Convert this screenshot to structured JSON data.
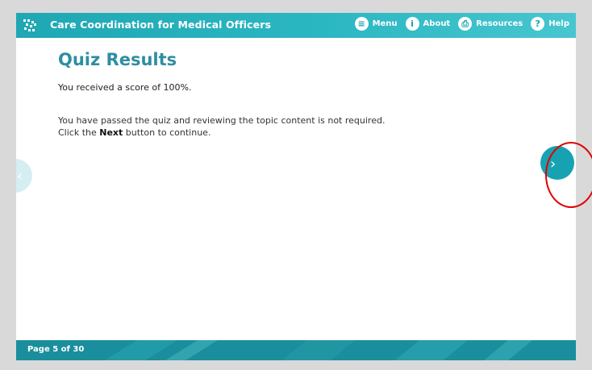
{
  "header": {
    "title": "Care Coordination for Medical Officers",
    "nav": [
      {
        "label": "Menu",
        "icon": "menu-icon",
        "glyph": "≡"
      },
      {
        "label": "About",
        "icon": "info-icon",
        "glyph": "i"
      },
      {
        "label": "Resources",
        "icon": "resources-icon",
        "glyph": "⎙"
      },
      {
        "label": "Help",
        "icon": "help-icon",
        "glyph": "?"
      }
    ]
  },
  "content": {
    "title": "Quiz Results",
    "score_text": "You received a score of 100%.",
    "message_line1": "You have passed the quiz and reviewing the topic content is not required.",
    "message_line2_before": "Click the ",
    "message_line2_bold": "Next",
    "message_line2_after": " button to continue."
  },
  "navigation": {
    "prev_glyph": "‹",
    "next_glyph": "›"
  },
  "footer": {
    "page_counter": "Page 5 of 30"
  },
  "colors": {
    "brand": "#1fa7b4",
    "title": "#2e8ea1",
    "footer": "#1a8e9c",
    "annotation": "#e00000"
  }
}
